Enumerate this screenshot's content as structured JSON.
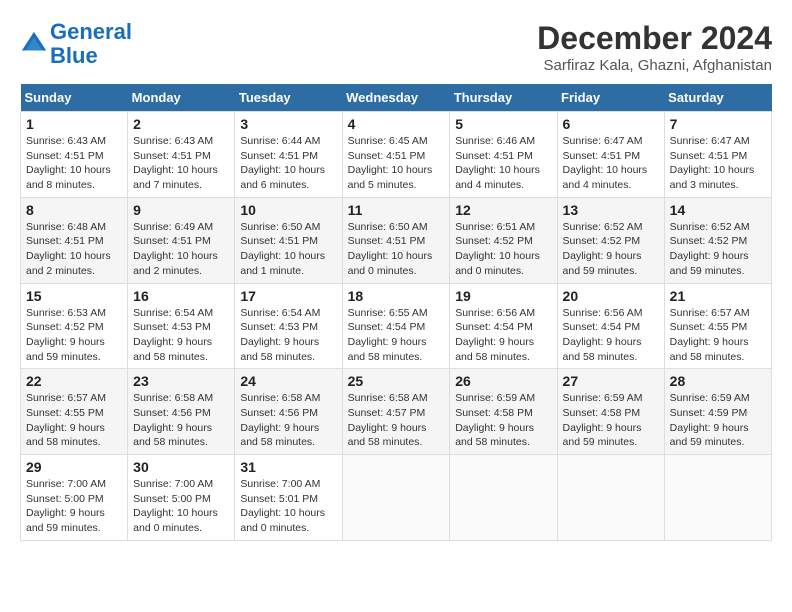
{
  "header": {
    "logo_line1": "General",
    "logo_line2": "Blue",
    "month": "December 2024",
    "location": "Sarfiraz Kala, Ghazni, Afghanistan"
  },
  "days_of_week": [
    "Sunday",
    "Monday",
    "Tuesday",
    "Wednesday",
    "Thursday",
    "Friday",
    "Saturday"
  ],
  "weeks": [
    [
      {
        "num": "1",
        "info": "Sunrise: 6:43 AM\nSunset: 4:51 PM\nDaylight: 10 hours\nand 8 minutes."
      },
      {
        "num": "2",
        "info": "Sunrise: 6:43 AM\nSunset: 4:51 PM\nDaylight: 10 hours\nand 7 minutes."
      },
      {
        "num": "3",
        "info": "Sunrise: 6:44 AM\nSunset: 4:51 PM\nDaylight: 10 hours\nand 6 minutes."
      },
      {
        "num": "4",
        "info": "Sunrise: 6:45 AM\nSunset: 4:51 PM\nDaylight: 10 hours\nand 5 minutes."
      },
      {
        "num": "5",
        "info": "Sunrise: 6:46 AM\nSunset: 4:51 PM\nDaylight: 10 hours\nand 4 minutes."
      },
      {
        "num": "6",
        "info": "Sunrise: 6:47 AM\nSunset: 4:51 PM\nDaylight: 10 hours\nand 4 minutes."
      },
      {
        "num": "7",
        "info": "Sunrise: 6:47 AM\nSunset: 4:51 PM\nDaylight: 10 hours\nand 3 minutes."
      }
    ],
    [
      {
        "num": "8",
        "info": "Sunrise: 6:48 AM\nSunset: 4:51 PM\nDaylight: 10 hours\nand 2 minutes."
      },
      {
        "num": "9",
        "info": "Sunrise: 6:49 AM\nSunset: 4:51 PM\nDaylight: 10 hours\nand 2 minutes."
      },
      {
        "num": "10",
        "info": "Sunrise: 6:50 AM\nSunset: 4:51 PM\nDaylight: 10 hours\nand 1 minute."
      },
      {
        "num": "11",
        "info": "Sunrise: 6:50 AM\nSunset: 4:51 PM\nDaylight: 10 hours\nand 0 minutes."
      },
      {
        "num": "12",
        "info": "Sunrise: 6:51 AM\nSunset: 4:52 PM\nDaylight: 10 hours\nand 0 minutes."
      },
      {
        "num": "13",
        "info": "Sunrise: 6:52 AM\nSunset: 4:52 PM\nDaylight: 9 hours\nand 59 minutes."
      },
      {
        "num": "14",
        "info": "Sunrise: 6:52 AM\nSunset: 4:52 PM\nDaylight: 9 hours\nand 59 minutes."
      }
    ],
    [
      {
        "num": "15",
        "info": "Sunrise: 6:53 AM\nSunset: 4:52 PM\nDaylight: 9 hours\nand 59 minutes."
      },
      {
        "num": "16",
        "info": "Sunrise: 6:54 AM\nSunset: 4:53 PM\nDaylight: 9 hours\nand 58 minutes."
      },
      {
        "num": "17",
        "info": "Sunrise: 6:54 AM\nSunset: 4:53 PM\nDaylight: 9 hours\nand 58 minutes."
      },
      {
        "num": "18",
        "info": "Sunrise: 6:55 AM\nSunset: 4:54 PM\nDaylight: 9 hours\nand 58 minutes."
      },
      {
        "num": "19",
        "info": "Sunrise: 6:56 AM\nSunset: 4:54 PM\nDaylight: 9 hours\nand 58 minutes."
      },
      {
        "num": "20",
        "info": "Sunrise: 6:56 AM\nSunset: 4:54 PM\nDaylight: 9 hours\nand 58 minutes."
      },
      {
        "num": "21",
        "info": "Sunrise: 6:57 AM\nSunset: 4:55 PM\nDaylight: 9 hours\nand 58 minutes."
      }
    ],
    [
      {
        "num": "22",
        "info": "Sunrise: 6:57 AM\nSunset: 4:55 PM\nDaylight: 9 hours\nand 58 minutes."
      },
      {
        "num": "23",
        "info": "Sunrise: 6:58 AM\nSunset: 4:56 PM\nDaylight: 9 hours\nand 58 minutes."
      },
      {
        "num": "24",
        "info": "Sunrise: 6:58 AM\nSunset: 4:56 PM\nDaylight: 9 hours\nand 58 minutes."
      },
      {
        "num": "25",
        "info": "Sunrise: 6:58 AM\nSunset: 4:57 PM\nDaylight: 9 hours\nand 58 minutes."
      },
      {
        "num": "26",
        "info": "Sunrise: 6:59 AM\nSunset: 4:58 PM\nDaylight: 9 hours\nand 58 minutes."
      },
      {
        "num": "27",
        "info": "Sunrise: 6:59 AM\nSunset: 4:58 PM\nDaylight: 9 hours\nand 59 minutes."
      },
      {
        "num": "28",
        "info": "Sunrise: 6:59 AM\nSunset: 4:59 PM\nDaylight: 9 hours\nand 59 minutes."
      }
    ],
    [
      {
        "num": "29",
        "info": "Sunrise: 7:00 AM\nSunset: 5:00 PM\nDaylight: 9 hours\nand 59 minutes."
      },
      {
        "num": "30",
        "info": "Sunrise: 7:00 AM\nSunset: 5:00 PM\nDaylight: 10 hours\nand 0 minutes."
      },
      {
        "num": "31",
        "info": "Sunrise: 7:00 AM\nSunset: 5:01 PM\nDaylight: 10 hours\nand 0 minutes."
      },
      null,
      null,
      null,
      null
    ]
  ]
}
